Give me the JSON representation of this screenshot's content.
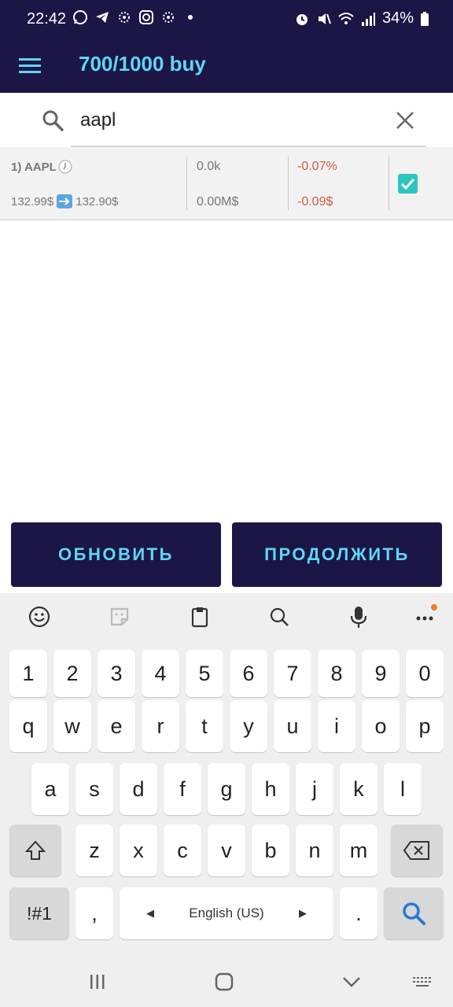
{
  "status": {
    "time": "22:42",
    "battery": "34%",
    "left_icons": [
      "whatsapp-icon",
      "telegram-icon",
      "app-icon",
      "instagram-icon",
      "app-icon",
      "dot-icon"
    ],
    "right_icons": [
      "alarm-icon",
      "mute-icon",
      "wifi-icon",
      "signal-icon",
      "battery-icon"
    ]
  },
  "app_bar": {
    "title": "700/1000 buy"
  },
  "search": {
    "value": "aapl"
  },
  "result": {
    "ticker": "1) AAPL",
    "price_from": "132.99$",
    "price_to": "132.90$",
    "volume": "0.0k",
    "volume_money": "0.00M$",
    "change_percent": "-0.07%",
    "change_value": "-0.09$",
    "checked": true
  },
  "buttons": {
    "refresh": "ОБНОВИТЬ",
    "continue": "ПРОДОЛЖИТЬ"
  },
  "colors": {
    "primary_dark": "#1b1646",
    "accent_cyan": "#5ed7f2",
    "negative": "#d0594a",
    "checkbox": "#2bc6c0"
  },
  "keyboard": {
    "row1": [
      "1",
      "2",
      "3",
      "4",
      "5",
      "6",
      "7",
      "8",
      "9",
      "0"
    ],
    "row2": [
      "q",
      "w",
      "e",
      "r",
      "t",
      "y",
      "u",
      "i",
      "o",
      "p"
    ],
    "row3": [
      "a",
      "s",
      "d",
      "f",
      "g",
      "h",
      "j",
      "k",
      "l"
    ],
    "row4": [
      "z",
      "x",
      "c",
      "v",
      "b",
      "n",
      "m"
    ],
    "symbols_key": "!#1",
    "comma_key": ",",
    "space_label": "English (US)",
    "period_key": "."
  }
}
